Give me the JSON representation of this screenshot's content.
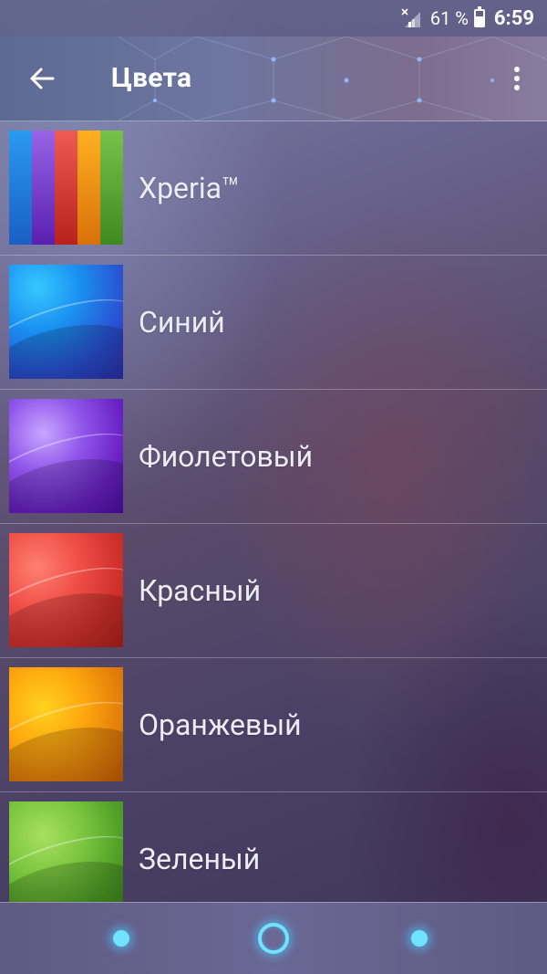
{
  "status_bar": {
    "signal_icon": "signal-no-sim-icon",
    "battery_percent": "61 %",
    "battery_icon": "battery-icon",
    "clock": "6:59"
  },
  "toolbar": {
    "back_icon": "arrow-back-icon",
    "title": "Цвета",
    "more_icon": "more-vert-icon"
  },
  "color_list": [
    {
      "label": "Xperia™",
      "swatch_colors": [
        "#1f88e0",
        "#7b3fcf",
        "#e34a4a",
        "#f59f1a",
        "#5cb338"
      ]
    },
    {
      "label": "Синий",
      "swatch_colors": [
        "#1aa7f2",
        "#2a45c9"
      ]
    },
    {
      "label": "Фиолетовый",
      "swatch_colors": [
        "#a877f3",
        "#5a19b8"
      ]
    },
    {
      "label": "Красный",
      "swatch_colors": [
        "#ff6e5e",
        "#c0241d"
      ]
    },
    {
      "label": "Оранжевый",
      "swatch_colors": [
        "#ffc21c",
        "#d96a05"
      ]
    },
    {
      "label": "Зеленый",
      "swatch_colors": [
        "#8fd14f",
        "#3e8a1e"
      ]
    }
  ],
  "nav_bar": {
    "back_icon": "nav-back-dot-icon",
    "home_icon": "nav-home-ring-icon",
    "recents_icon": "nav-recents-dot-icon",
    "accent": "#6fe3ff"
  }
}
